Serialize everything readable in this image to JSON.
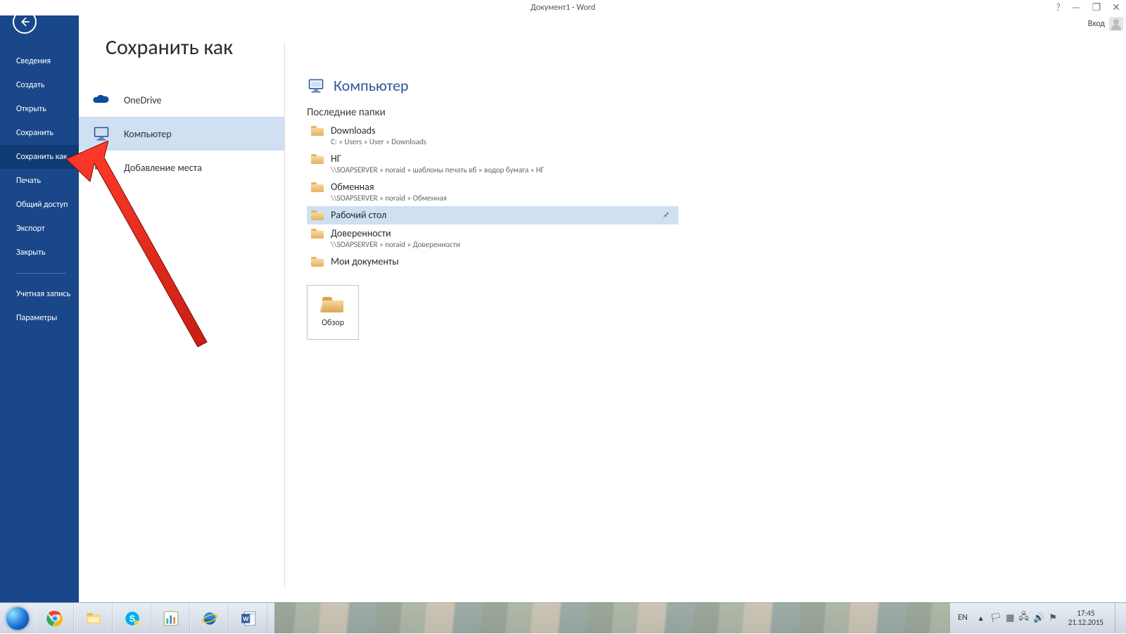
{
  "titlebar": {
    "document_title": "Документ1 - Word",
    "signin_label": "Вход"
  },
  "sidebar": {
    "items": [
      {
        "label": "Сведения"
      },
      {
        "label": "Создать"
      },
      {
        "label": "Открыть"
      },
      {
        "label": "Сохранить"
      },
      {
        "label": "Сохранить как"
      },
      {
        "label": "Печать"
      },
      {
        "label": "Общий доступ"
      },
      {
        "label": "Экспорт"
      },
      {
        "label": "Закрыть"
      }
    ],
    "footer": [
      {
        "label": "Учетная запись"
      },
      {
        "label": "Параметры"
      }
    ]
  },
  "center": {
    "heading": "Сохранить как",
    "locations": [
      {
        "key": "onedrive",
        "label": "OneDrive"
      },
      {
        "key": "computer",
        "label": "Компьютер"
      },
      {
        "key": "addplace",
        "label": "Добавление места"
      }
    ]
  },
  "right": {
    "heading": "Компьютер",
    "recent_header": "Последние папки",
    "recent": [
      {
        "name": "Downloads",
        "path": "C: » Users » User » Downloads"
      },
      {
        "name": "НГ",
        "path": "\\\\SOAPSERVER » noraid » шаблоны печать вб » водор бумага » НГ"
      },
      {
        "name": "Обменная",
        "path": "\\\\SOAPSERVER » noraid » Обменная"
      },
      {
        "name": "Рабочий стол",
        "path": ""
      },
      {
        "name": "Доверенности",
        "path": "\\\\SOAPSERVER » noraid » Доверенности"
      },
      {
        "name": "Мои документы",
        "path": ""
      }
    ],
    "browse_label": "Обзор"
  },
  "taskbar": {
    "lang": "EN",
    "time": "17:45",
    "date": "21.12.2015"
  }
}
